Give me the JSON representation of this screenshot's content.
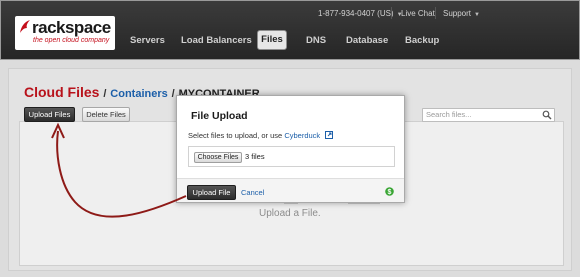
{
  "logo": {
    "word": "rackspace",
    "tagline": "the open cloud company"
  },
  "topbar": {
    "phone": "1-877-934-0407 (US)",
    "live_chat": "Live Chat",
    "support": "Support"
  },
  "nav": {
    "items": [
      "Servers",
      "Load Balancers",
      "Files",
      "DNS",
      "Database",
      "Backup"
    ],
    "active": "Files"
  },
  "breadcrumb": {
    "section": "Cloud Files",
    "sep1": "/",
    "containers": "Containers",
    "sep2": "/",
    "container": "MYCONTAINER"
  },
  "toolbar": {
    "upload_files": "Upload Files",
    "delete_files": "Delete Files"
  },
  "search": {
    "placeholder": "Search files..."
  },
  "background": {
    "hint": "Upload a File."
  },
  "modal": {
    "title": "File Upload",
    "instruction": "Select files to upload, or use",
    "link": "Cyberduck",
    "choose_button": "Choose Files",
    "file_count": "3 files",
    "upload_button": "Upload File",
    "cancel": "Cancel"
  },
  "colors": {
    "brand_red": "#b8121b",
    "link_blue": "#1c5fa9",
    "arrow_red": "#8e1a17",
    "help_green": "#3aa635"
  }
}
